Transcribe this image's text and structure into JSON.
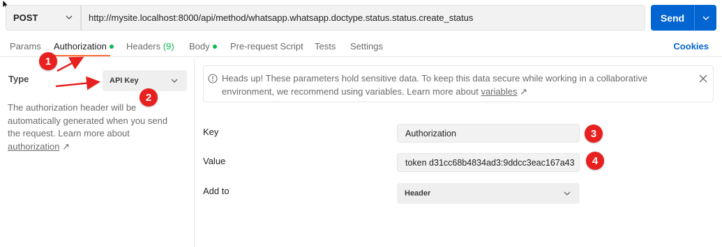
{
  "request": {
    "method": "POST",
    "url": "http://mysite.localhost:8000/api/method/whatsapp.whatsapp.doctype.status.status.create_status",
    "send_label": "Send"
  },
  "tabs": [
    {
      "label": "Params"
    },
    {
      "label": "Authorization"
    },
    {
      "label": "Headers",
      "count": "(9)"
    },
    {
      "label": "Body"
    },
    {
      "label": "Pre-request Script"
    },
    {
      "label": "Tests"
    },
    {
      "label": "Settings"
    }
  ],
  "cookies_label": "Cookies",
  "auth": {
    "type_label": "Type",
    "type_value": "API Key",
    "help_text": "The authorization header will be automatically generated when you send the request. Learn more about",
    "help_link": "authorization",
    "link_arrow": "↗"
  },
  "notice": {
    "text": "Heads up! These parameters hold sensitive data. To keep this data secure while working in a collaborative environment, we recommend using variables. Learn more about",
    "link": "variables",
    "link_arrow": "↗"
  },
  "fields": {
    "key_label": "Key",
    "key_value": "Authorization",
    "value_label": "Value",
    "value_value": "token d31cc68b4834ad3:9ddcc3eac167a43",
    "addto_label": "Add to",
    "addto_value": "Header"
  },
  "annotations": [
    "1",
    "2",
    "3",
    "4"
  ],
  "colors": {
    "send": "#0265d2",
    "tab_active_underline": "#ff6c37",
    "status_dot": "#0cbb52",
    "annotation": "#e8201f"
  }
}
